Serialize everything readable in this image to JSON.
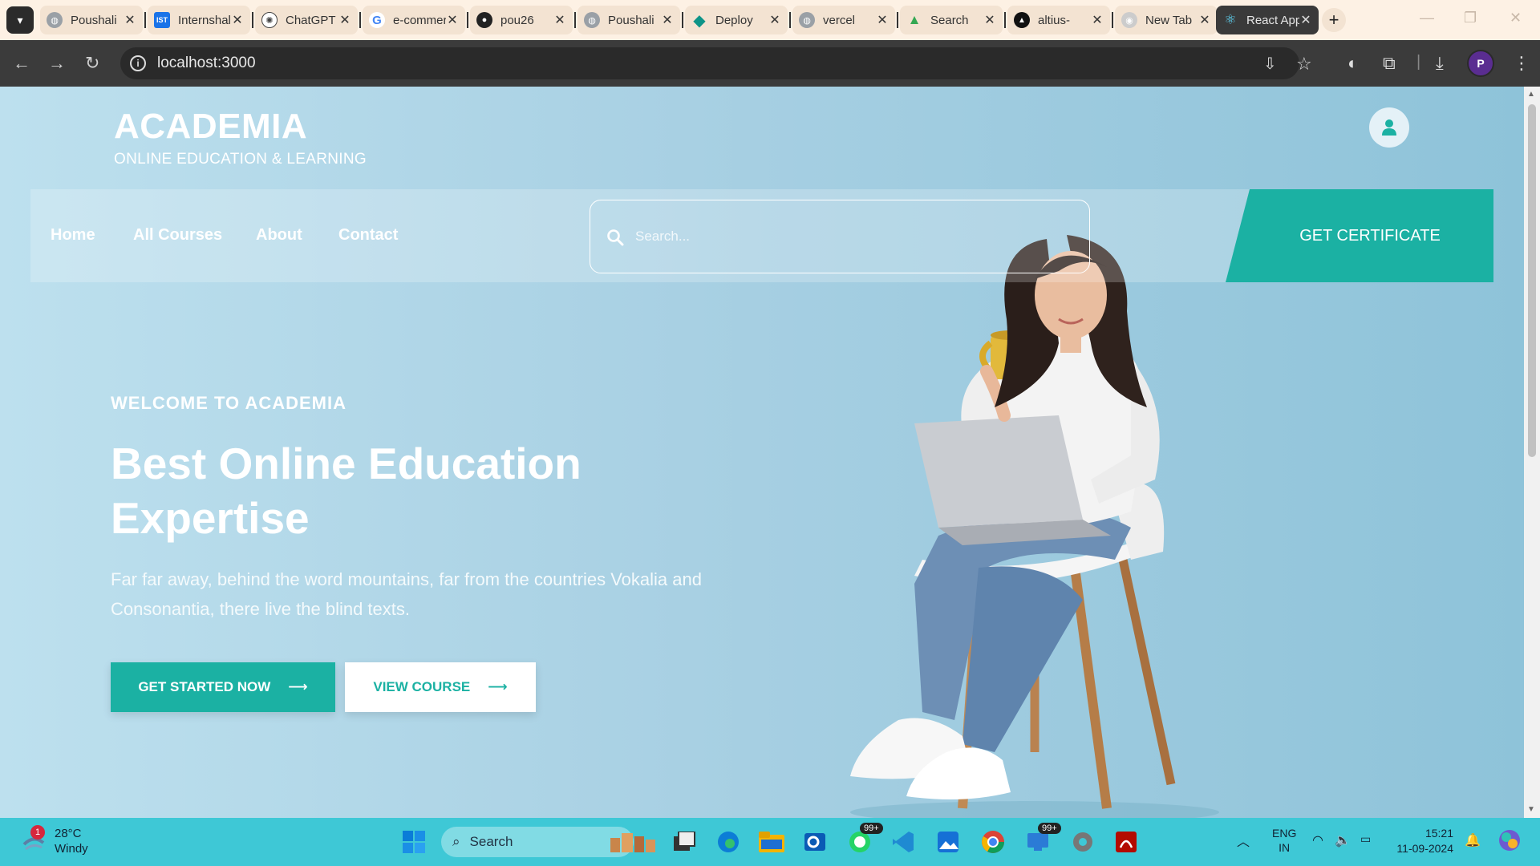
{
  "browser": {
    "tabs": [
      {
        "title": "Poushali",
        "icon": "globe-icon",
        "color": "#9aa0a6"
      },
      {
        "title": "Internshala",
        "icon": "ist-icon",
        "color": "#1a73e8"
      },
      {
        "title": "ChatGPT",
        "icon": "chatgpt-icon",
        "color": "#444444"
      },
      {
        "title": "e-commerce",
        "icon": "google-icon",
        "color": "#4285f4"
      },
      {
        "title": "pou26",
        "icon": "github-icon",
        "color": "#222222"
      },
      {
        "title": "Poushali",
        "icon": "globe-icon",
        "color": "#9aa0a6"
      },
      {
        "title": "Deploy",
        "icon": "deploy-icon",
        "color": "#0d9488"
      },
      {
        "title": "vercel",
        "icon": "globe-icon",
        "color": "#9aa0a6"
      },
      {
        "title": "Search",
        "icon": "drive-icon",
        "color": "#34a853"
      },
      {
        "title": "altius-",
        "icon": "vercel-icon",
        "color": "#111111"
      },
      {
        "title": "New Tab",
        "icon": "chrome-icon",
        "color": "#cccccc"
      },
      {
        "title": "React App",
        "icon": "react-icon",
        "color": "#61dafb"
      }
    ],
    "ist_label": "IST",
    "url": "localhost:3000",
    "profile_initial": "P"
  },
  "site": {
    "brand_title": "ACADEMIA",
    "brand_subtitle": "ONLINE EDUCATION & LEARNING",
    "nav": [
      "Home",
      "All Courses",
      "About",
      "Contact"
    ],
    "search_placeholder": "Search...",
    "cta_certificate": "GET CERTIFICATE",
    "hero": {
      "eyebrow": "WELCOME TO ACADEMIA",
      "headline": "Best Online Education Expertise",
      "lead": "Far far away, behind the word mountains, far from the countries Vokalia and Consonantia, there live the blind texts.",
      "primary_button": "GET STARTED NOW",
      "secondary_button": "VIEW COURSE"
    },
    "accent_color": "#1bb1a3"
  },
  "taskbar": {
    "weather_temp": "28°C",
    "weather_desc": "Windy",
    "weather_badge": "1",
    "search_label": "Search",
    "whatsapp_badge": "99+",
    "teams_badge": "99+",
    "lang_top": "ENG",
    "lang_bottom": "IN",
    "time": "15:21",
    "date": "11-09-2024"
  }
}
